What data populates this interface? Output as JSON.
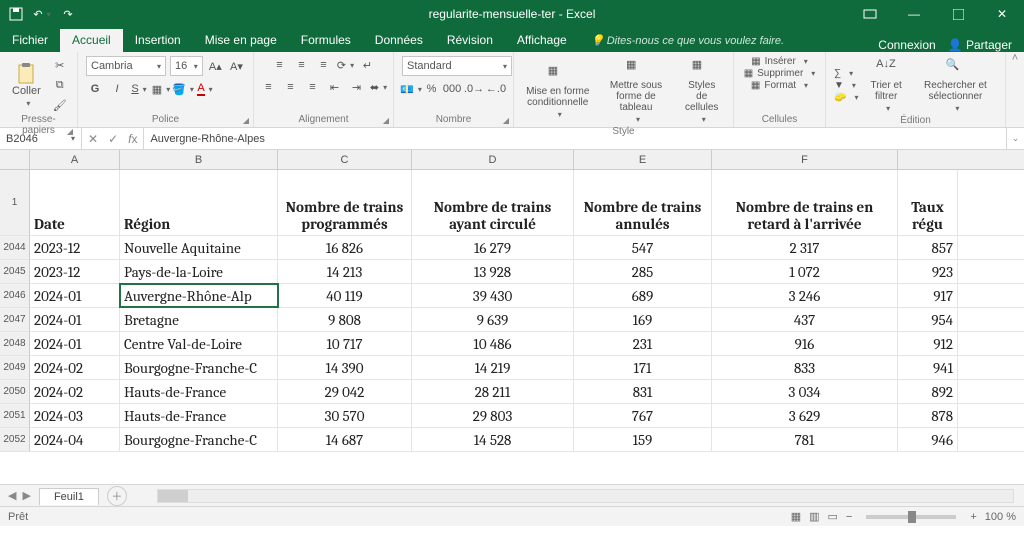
{
  "title": "regularite-mensuelle-ter - Excel",
  "tabs": {
    "file": "Fichier",
    "home": "Accueil",
    "insert": "Insertion",
    "layout": "Mise en page",
    "formulas": "Formules",
    "data": "Données",
    "review": "Révision",
    "view": "Affichage"
  },
  "tellme": "Dites-nous ce que vous voulez faire.",
  "signin": "Connexion",
  "share": "Partager",
  "ribbon": {
    "clipboard": {
      "paste": "Coller",
      "label": "Presse-papiers"
    },
    "font": {
      "name": "Cambria",
      "size": "16",
      "label": "Police"
    },
    "align": {
      "label": "Alignement"
    },
    "number": {
      "format": "Standard",
      "label": "Nombre"
    },
    "styles": {
      "cond": "Mise en forme conditionnelle",
      "table": "Mettre sous forme de tableau",
      "cell": "Styles de cellules",
      "label": "Style"
    },
    "cells": {
      "insert": "Insérer",
      "delete": "Supprimer",
      "format": "Format",
      "label": "Cellules"
    },
    "editing": {
      "sort": "Trier et filtrer",
      "find": "Rechercher et sélectionner",
      "label": "Édition"
    }
  },
  "namebox": "B2046",
  "formula": "Auvergne-Rhône-Alpes",
  "columns": [
    "A",
    "B",
    "C",
    "D",
    "E",
    "F"
  ],
  "headers": {
    "row": "1",
    "A": "Date",
    "B": "Région",
    "C": "Nombre de trains programmés",
    "D": "Nombre de trains ayant circulé",
    "E": "Nombre de trains annulés",
    "F": "Nombre de trains en retard à l'arrivée",
    "G": "Taux régu"
  },
  "rows": [
    {
      "n": "2044",
      "A": "2023-12",
      "B": "Nouvelle Aquitaine",
      "C": "16 826",
      "D": "16 279",
      "E": "547",
      "F": "2 317",
      "G": "857"
    },
    {
      "n": "2045",
      "A": "2023-12",
      "B": "Pays-de-la-Loire",
      "C": "14 213",
      "D": "13 928",
      "E": "285",
      "F": "1 072",
      "G": "923"
    },
    {
      "n": "2046",
      "A": "2024-01",
      "B": "Auvergne-Rhône-Alp",
      "C": "40 119",
      "D": "39 430",
      "E": "689",
      "F": "3 246",
      "G": "917"
    },
    {
      "n": "2047",
      "A": "2024-01",
      "B": "Bretagne",
      "C": "9 808",
      "D": "9 639",
      "E": "169",
      "F": "437",
      "G": "954"
    },
    {
      "n": "2048",
      "A": "2024-01",
      "B": "Centre Val-de-Loire",
      "C": "10 717",
      "D": "10 486",
      "E": "231",
      "F": "916",
      "G": "912"
    },
    {
      "n": "2049",
      "A": "2024-02",
      "B": "Bourgogne-Franche-C",
      "C": "14 390",
      "D": "14 219",
      "E": "171",
      "F": "833",
      "G": "941"
    },
    {
      "n": "2050",
      "A": "2024-02",
      "B": "Hauts-de-France",
      "C": "29 042",
      "D": "28 211",
      "E": "831",
      "F": "3 034",
      "G": "892"
    },
    {
      "n": "2051",
      "A": "2024-03",
      "B": "Hauts-de-France",
      "C": "30 570",
      "D": "29 803",
      "E": "767",
      "F": "3 629",
      "G": "878"
    },
    {
      "n": "2052",
      "A": "2024-04",
      "B": "Bourgogne-Franche-C",
      "C": "14 687",
      "D": "14 528",
      "E": "159",
      "F": "781",
      "G": "946"
    }
  ],
  "sheet": "Feuil1",
  "status": "Prêt",
  "zoom": "100 %",
  "chart_data": {
    "type": "table",
    "title": "regularite-mensuelle-ter",
    "columns": [
      "Date",
      "Région",
      "Nombre de trains programmés",
      "Nombre de trains ayant circulé",
      "Nombre de trains annulés",
      "Nombre de trains en retard à l'arrivée"
    ],
    "rows": [
      [
        "2023-12",
        "Nouvelle Aquitaine",
        16826,
        16279,
        547,
        2317
      ],
      [
        "2023-12",
        "Pays-de-la-Loire",
        14213,
        13928,
        285,
        1072
      ],
      [
        "2024-01",
        "Auvergne-Rhône-Alpes",
        40119,
        39430,
        689,
        3246
      ],
      [
        "2024-01",
        "Bretagne",
        9808,
        9639,
        169,
        437
      ],
      [
        "2024-01",
        "Centre Val-de-Loire",
        10717,
        10486,
        231,
        916
      ],
      [
        "2024-02",
        "Bourgogne-Franche-Comté",
        14390,
        14219,
        171,
        833
      ],
      [
        "2024-02",
        "Hauts-de-France",
        29042,
        28211,
        831,
        3034
      ],
      [
        "2024-03",
        "Hauts-de-France",
        30570,
        29803,
        767,
        3629
      ],
      [
        "2024-04",
        "Bourgogne-Franche-Comté",
        14687,
        14528,
        159,
        781
      ]
    ]
  }
}
